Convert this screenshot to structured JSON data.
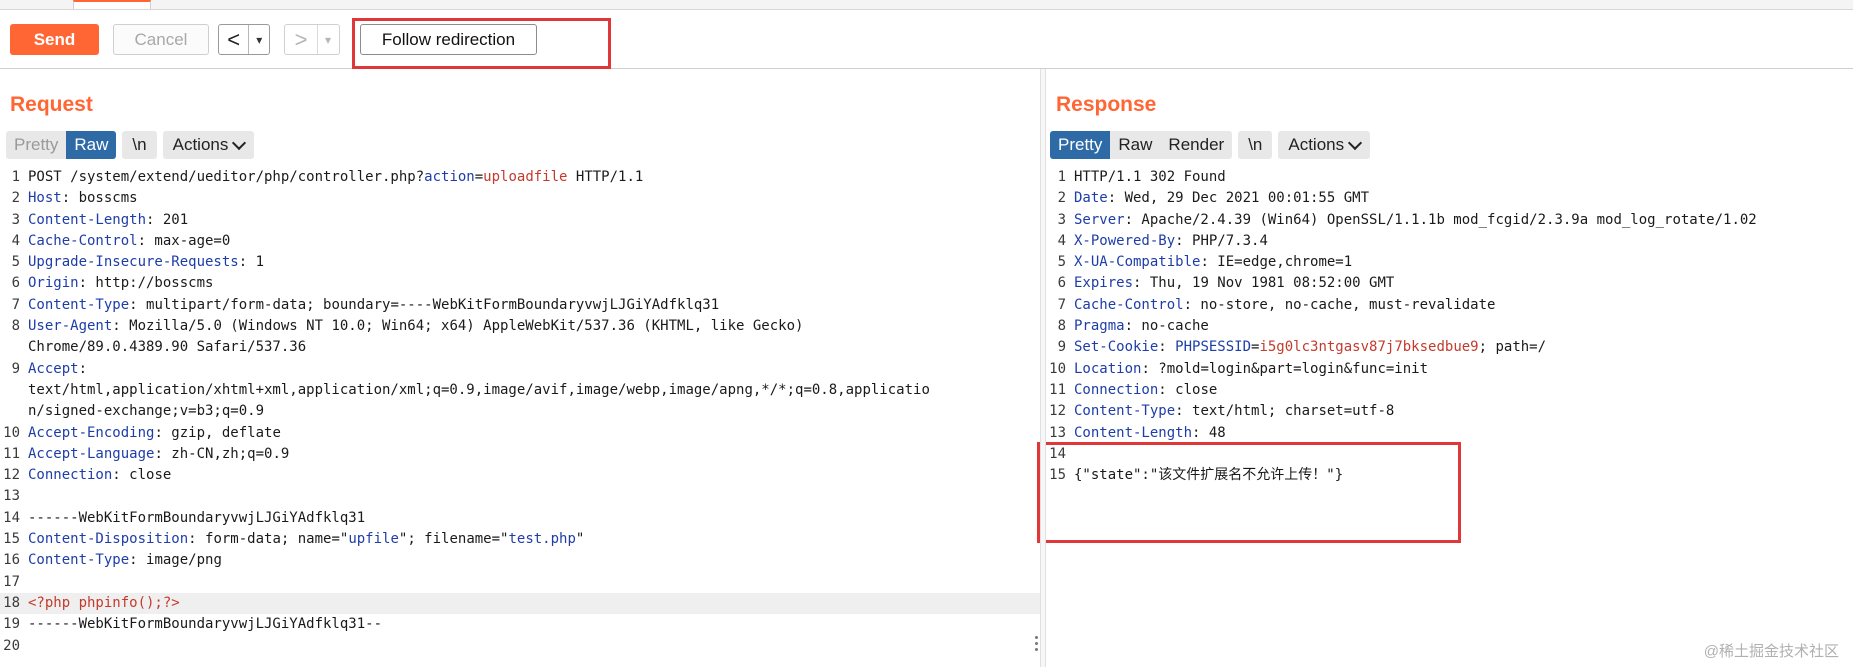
{
  "toolbar": {
    "send_label": "Send",
    "cancel_label": "Cancel",
    "back_arrow": "<",
    "forward_arrow": ">",
    "dropdown_glyph": "▾",
    "follow_label": "Follow redirection"
  },
  "request": {
    "title": "Request",
    "view_tabs": [
      "Pretty",
      "Raw"
    ],
    "active_tab": "Raw",
    "newline_label": "\\n",
    "actions_label": "Actions",
    "lines": [
      {
        "n": "1",
        "segs": [
          [
            "POST /system/extend/ueditor/php/controller.php?",
            ""
          ],
          [
            "action",
            "k"
          ],
          [
            "=",
            ""
          ],
          [
            "uploadfile",
            "r"
          ],
          [
            " HTTP/1.1",
            ""
          ]
        ]
      },
      {
        "n": "2",
        "segs": [
          [
            "Host",
            "k"
          ],
          [
            ": bosscms",
            ""
          ]
        ]
      },
      {
        "n": "3",
        "segs": [
          [
            "Content-Length",
            "k"
          ],
          [
            ": 201",
            ""
          ]
        ]
      },
      {
        "n": "4",
        "segs": [
          [
            "Cache-Control",
            "k"
          ],
          [
            ": max-age=0",
            ""
          ]
        ]
      },
      {
        "n": "5",
        "segs": [
          [
            "Upgrade-Insecure-Requests",
            "k"
          ],
          [
            ": 1",
            ""
          ]
        ]
      },
      {
        "n": "6",
        "segs": [
          [
            "Origin",
            "k"
          ],
          [
            ": http://bosscms",
            ""
          ]
        ]
      },
      {
        "n": "7",
        "segs": [
          [
            "Content-Type",
            "k"
          ],
          [
            ": multipart/form-data; boundary=----WebKitFormBoundaryvwjLJGiYAdfklq31",
            ""
          ]
        ]
      },
      {
        "n": "8",
        "segs": [
          [
            "User-Agent",
            "k"
          ],
          [
            ": Mozilla/5.0 (Windows NT 10.0; Win64; x64) AppleWebKit/537.36 (KHTML, like Gecko)",
            ""
          ]
        ]
      },
      {
        "n": "",
        "segs": [
          [
            "Chrome/89.0.4389.90 Safari/537.36",
            ""
          ]
        ]
      },
      {
        "n": "9",
        "segs": [
          [
            "Accept",
            "k"
          ],
          [
            ":",
            ""
          ]
        ]
      },
      {
        "n": "",
        "segs": [
          [
            "text/html,application/xhtml+xml,application/xml;q=0.9,image/avif,image/webp,image/apng,*/*;q=0.8,applicatio",
            ""
          ]
        ]
      },
      {
        "n": "",
        "segs": [
          [
            "n/signed-exchange;v=b3;q=0.9",
            ""
          ]
        ]
      },
      {
        "n": "10",
        "segs": [
          [
            "Accept-Encoding",
            "k"
          ],
          [
            ": gzip, deflate",
            ""
          ]
        ]
      },
      {
        "n": "11",
        "segs": [
          [
            "Accept-Language",
            "k"
          ],
          [
            ": zh-CN,zh;q=0.9",
            ""
          ]
        ]
      },
      {
        "n": "12",
        "segs": [
          [
            "Connection",
            "k"
          ],
          [
            ": close",
            ""
          ]
        ]
      },
      {
        "n": "13",
        "segs": []
      },
      {
        "n": "14",
        "segs": [
          [
            "------WebKitFormBoundaryvwjLJGiYAdfklq31",
            ""
          ]
        ]
      },
      {
        "n": "15",
        "segs": [
          [
            "Content-Disposition",
            "k"
          ],
          [
            ": form-data; name=\"",
            ""
          ],
          [
            "upfile",
            "s"
          ],
          [
            "\"; filename=\"",
            ""
          ],
          [
            "test.php",
            "s"
          ],
          [
            "\"",
            ""
          ]
        ]
      },
      {
        "n": "16",
        "segs": [
          [
            "Content-Type",
            "k"
          ],
          [
            ": image/png",
            ""
          ]
        ]
      },
      {
        "n": "17",
        "segs": []
      },
      {
        "n": "18",
        "segs": [
          [
            "<?php phpinfo();?>",
            "r"
          ]
        ],
        "hl": true
      },
      {
        "n": "19",
        "segs": [
          [
            "------WebKitFormBoundaryvwjLJGiYAdfklq31--",
            ""
          ]
        ]
      },
      {
        "n": "20",
        "segs": []
      }
    ]
  },
  "response": {
    "title": "Response",
    "view_tabs": [
      "Pretty",
      "Raw",
      "Render"
    ],
    "active_tab": "Pretty",
    "newline_label": "\\n",
    "actions_label": "Actions",
    "lines": [
      {
        "n": "1",
        "segs": [
          [
            "HTTP/1.1 302 Found",
            ""
          ]
        ]
      },
      {
        "n": "2",
        "segs": [
          [
            "Date",
            "k"
          ],
          [
            ": Wed, 29 Dec 2021 00:01:55 GMT",
            ""
          ]
        ]
      },
      {
        "n": "3",
        "segs": [
          [
            "Server",
            "k"
          ],
          [
            ": Apache/2.4.39 (Win64) OpenSSL/1.1.1b mod_fcgid/2.3.9a mod_log_rotate/1.02",
            ""
          ]
        ]
      },
      {
        "n": "4",
        "segs": [
          [
            "X-Powered-By",
            "k"
          ],
          [
            ": PHP/7.3.4",
            ""
          ]
        ]
      },
      {
        "n": "5",
        "segs": [
          [
            "X-UA-Compatible",
            "k"
          ],
          [
            ": IE=edge,chrome=1",
            ""
          ]
        ]
      },
      {
        "n": "6",
        "segs": [
          [
            "Expires",
            "k"
          ],
          [
            ": Thu, 19 Nov 1981 08:52:00 GMT",
            ""
          ]
        ]
      },
      {
        "n": "7",
        "segs": [
          [
            "Cache-Control",
            "k"
          ],
          [
            ": no-store, no-cache, must-revalidate",
            ""
          ]
        ]
      },
      {
        "n": "8",
        "segs": [
          [
            "Pragma",
            "k"
          ],
          [
            ": no-cache",
            ""
          ]
        ]
      },
      {
        "n": "9",
        "segs": [
          [
            "Set-Cookie",
            "k"
          ],
          [
            ": ",
            ""
          ],
          [
            "PHPSESSID",
            "k"
          ],
          [
            "=",
            ""
          ],
          [
            "i5g0lc3ntgasv87j7bksedbue9",
            "r"
          ],
          [
            "; path=/",
            ""
          ]
        ]
      },
      {
        "n": "10",
        "segs": [
          [
            "Location",
            "k"
          ],
          [
            ": ?mold=login&part=login&func=init",
            ""
          ]
        ]
      },
      {
        "n": "11",
        "segs": [
          [
            "Connection",
            "k"
          ],
          [
            ": close",
            ""
          ]
        ]
      },
      {
        "n": "12",
        "segs": [
          [
            "Content-Type",
            "k"
          ],
          [
            ": text/html; charset=utf-8",
            ""
          ]
        ]
      },
      {
        "n": "13",
        "segs": [
          [
            "Content-Length",
            "k"
          ],
          [
            ": 48",
            ""
          ]
        ]
      },
      {
        "n": "14",
        "segs": []
      },
      {
        "n": "15",
        "segs": [
          [
            "{\"state\":\"该文件扩展名不允许上传！\"}",
            ""
          ]
        ]
      }
    ]
  },
  "watermark": "@稀土掘金技术社区",
  "colors": {
    "accent": "#ff6633",
    "active_tab": "#2e6aa6",
    "header_key": "#1e3da8",
    "value_red": "#c43a2c",
    "highlight_box": "#e03838"
  }
}
